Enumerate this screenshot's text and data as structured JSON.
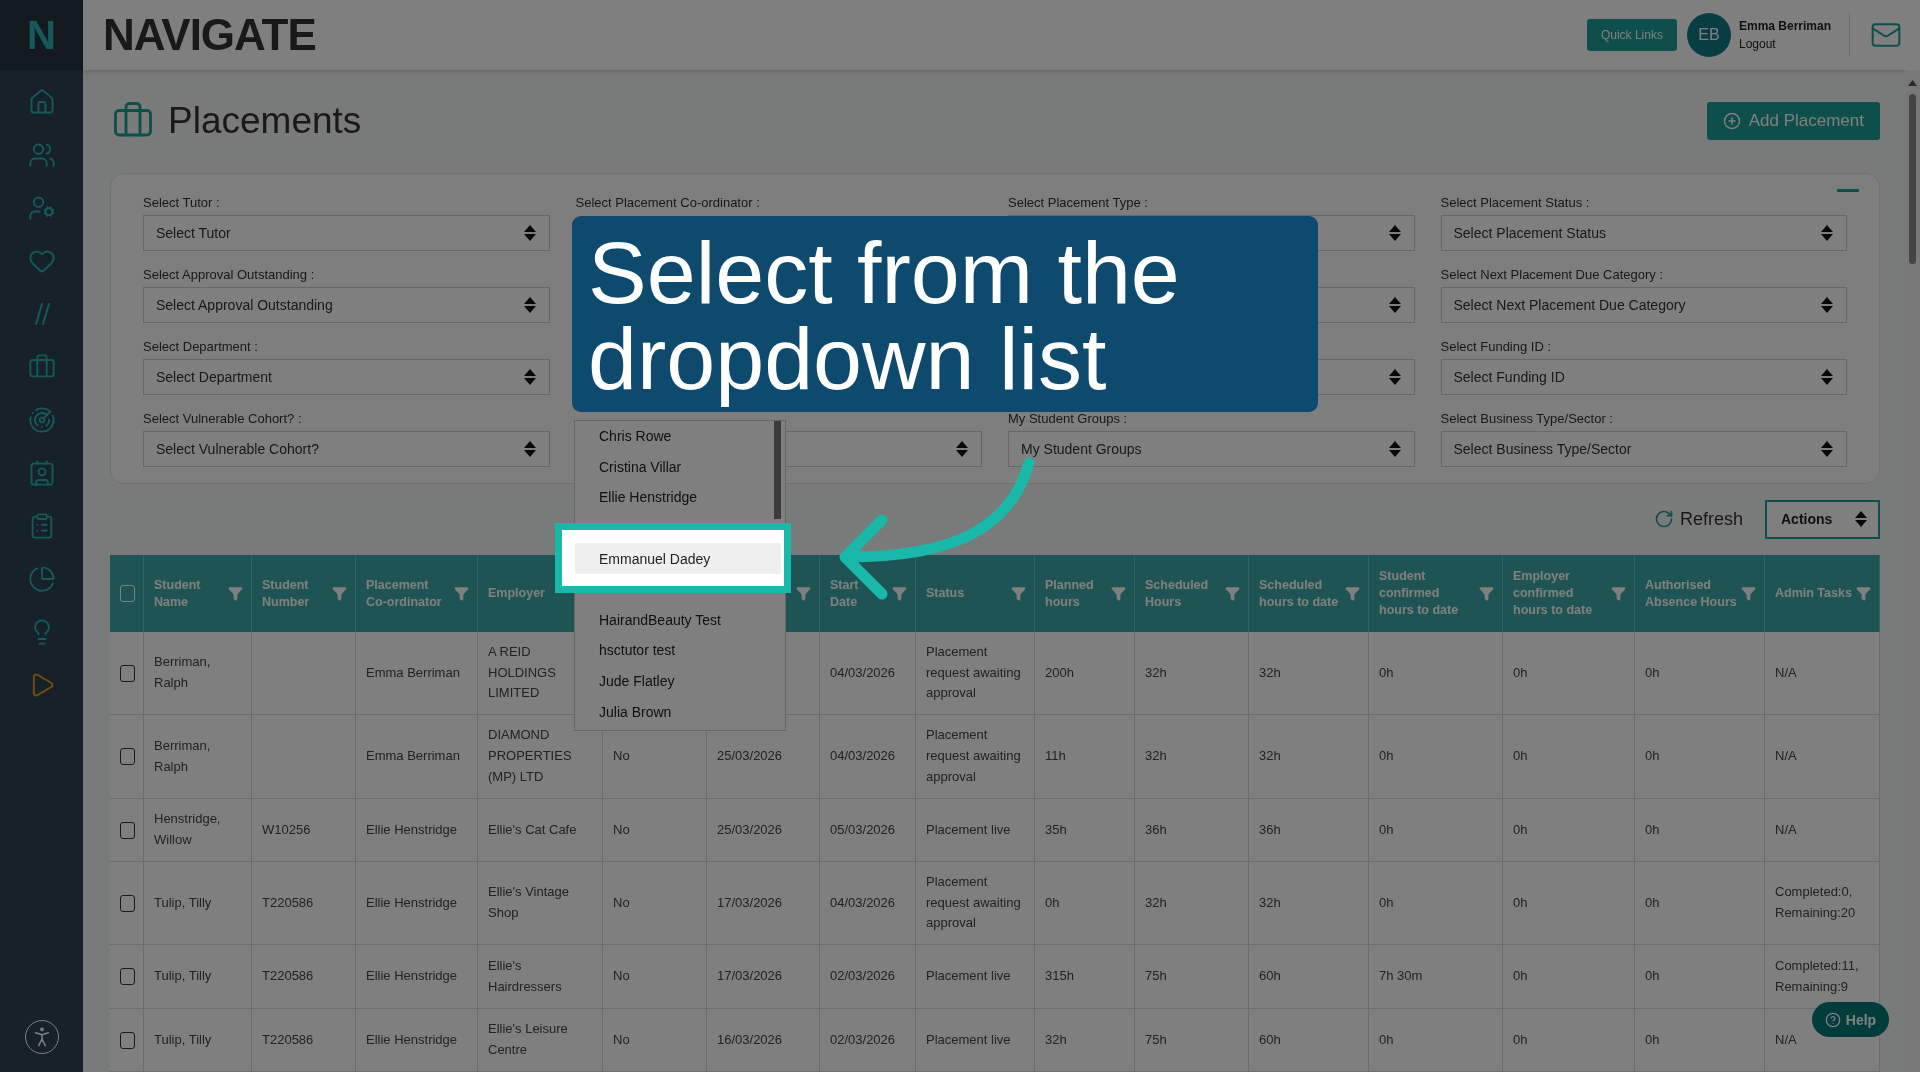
{
  "sidebar": {
    "logo": "N"
  },
  "header": {
    "logo": "NAVIGATE",
    "quick_links": "Quick Links",
    "user": {
      "initials": "EB",
      "name": "Emma Berriman",
      "link": "Logout"
    }
  },
  "page": {
    "title": "Placements",
    "add_button": "Add Placement"
  },
  "filters": [
    {
      "kind": "select",
      "label": "Select Tutor :",
      "value": "Select Tutor"
    },
    {
      "kind": "label_only",
      "label": "Select Placement Co-ordinator :"
    },
    {
      "kind": "select",
      "label": "Select Placement Type :"
    },
    {
      "kind": "select",
      "label": "Select Placement Status :",
      "value": "Select Placement Status"
    },
    {
      "kind": "select",
      "label": "Select Approval Outstanding :",
      "value": "Select Approval Outstanding"
    },
    {
      "kind": "hidden"
    },
    {
      "kind": "select"
    },
    {
      "kind": "select",
      "label": "Select Next Placement Due Category :",
      "value": "Select Next Placement Due Category"
    },
    {
      "kind": "select",
      "label": "Select Department :",
      "value": "Select Department"
    },
    {
      "kind": "hidden"
    },
    {
      "kind": "select"
    },
    {
      "kind": "select",
      "label": "Select Funding ID :",
      "value": "Select Funding ID"
    },
    {
      "kind": "select",
      "label": "Select Vulnerable Cohort? :",
      "value": "Select Vulnerable Cohort?"
    },
    {
      "kind": "select"
    },
    {
      "kind": "select",
      "label": "My Student Groups :",
      "value": "My Student Groups"
    },
    {
      "kind": "select",
      "label": "Select Business Type/Sector :",
      "value": "Select Business Type/Sector"
    }
  ],
  "toolbar": {
    "refresh": "Refresh",
    "actions": "Actions"
  },
  "table": {
    "select_all_checked": false,
    "columns": [
      {
        "kind": "label",
        "label": "Student Name"
      },
      {
        "kind": "label",
        "label": "Student Number"
      },
      {
        "kind": "label",
        "label": "Placement Co-ordinator"
      },
      {
        "kind": "plain",
        "label": "Employer"
      },
      {
        "kind": "hidden"
      },
      {
        "kind": "filter_only"
      },
      {
        "kind": "label",
        "label": "Start Date"
      },
      {
        "kind": "label",
        "label": "Status"
      },
      {
        "kind": "label",
        "label": "Planned hours"
      },
      {
        "kind": "label",
        "label": "Scheduled Hours"
      },
      {
        "kind": "label",
        "label": "Scheduled hours to date"
      },
      {
        "kind": "label",
        "label": "Student confirmed hours to date"
      },
      {
        "kind": "label",
        "label": "Employer confirmed hours to date"
      },
      {
        "kind": "label",
        "label": "Authorised Absence Hours"
      },
      {
        "kind": "label",
        "label": "Admin Tasks"
      }
    ],
    "rows": [
      {
        "checked": false,
        "cells": [
          "Berriman, Ralph",
          null,
          "Emma Berriman",
          "A REID HOLDINGS LIMITED",
          {
            "kind": "hidden"
          },
          null,
          "04/03/2026",
          "Placement request awaiting approval",
          "200h",
          "32h",
          "32h",
          "0h",
          "0h",
          "0h",
          "N/A"
        ]
      },
      {
        "checked": false,
        "cells": [
          "Berriman, Ralph",
          null,
          "Emma Berriman",
          "DIAMOND PROPERTIES (MP) LTD",
          "No",
          "25/03/2026",
          "04/03/2026",
          "Placement request awaiting approval",
          "11h",
          "32h",
          "32h",
          "0h",
          "0h",
          "0h",
          "N/A"
        ]
      },
      {
        "checked": false,
        "cells": [
          "Henstridge, Willow",
          "W10256",
          "Ellie Henstridge",
          "Ellie's Cat Cafe",
          "No",
          "25/03/2026",
          "05/03/2026",
          "Placement live",
          "35h",
          "36h",
          "36h",
          "0h",
          "0h",
          "0h",
          "N/A"
        ]
      },
      {
        "checked": false,
        "cells": [
          "Tulip, Tilly",
          "T220586",
          "Ellie Henstridge",
          "Ellie's Vintage Shop",
          "No",
          "17/03/2026",
          "04/03/2026",
          "Placement request awaiting approval",
          "0h",
          "32h",
          "32h",
          "0h",
          "0h",
          "0h",
          "Completed:0, Remaining:20"
        ]
      },
      {
        "checked": false,
        "cells": [
          "Tulip, Tilly",
          "T220586",
          "Ellie Henstridge",
          "Ellie's Hairdressers",
          "No",
          "17/03/2026",
          "02/03/2026",
          "Placement live",
          "315h",
          "75h",
          "60h",
          "7h 30m",
          "0h",
          "0h",
          "Completed:11, Remaining:9"
        ]
      },
      {
        "checked": false,
        "cells": [
          "Tulip, Tilly",
          "T220586",
          "Ellie Henstridge",
          "Ellie's Leisure Centre",
          "No",
          "16/03/2026",
          "02/03/2026",
          "Placement live",
          "32h",
          "75h",
          "60h",
          "0h",
          "0h",
          "0h",
          "N/A"
        ]
      }
    ]
  },
  "dropdown": {
    "items": [
      {
        "kind": "option",
        "label": "Chris Rowe",
        "selected": false
      },
      {
        "kind": "option",
        "label": "Cristina Villar",
        "selected": false
      },
      {
        "kind": "option",
        "label": "Ellie Henstridge",
        "selected": false
      },
      {
        "kind": "hidden"
      },
      {
        "kind": "option",
        "label": "Emmanuel Dadey",
        "selected": true
      },
      {
        "kind": "hidden"
      },
      {
        "kind": "option",
        "label": "HairandBeauty Test",
        "selected": false
      },
      {
        "kind": "option",
        "label": "hsctutor test",
        "selected": false
      },
      {
        "kind": "option",
        "label": "Jude Flatley",
        "selected": false
      },
      {
        "kind": "option",
        "label": "Julia Brown",
        "selected": false
      }
    ]
  },
  "callout": {
    "text": "Select from the dropdown list"
  },
  "help_button": "Help"
}
